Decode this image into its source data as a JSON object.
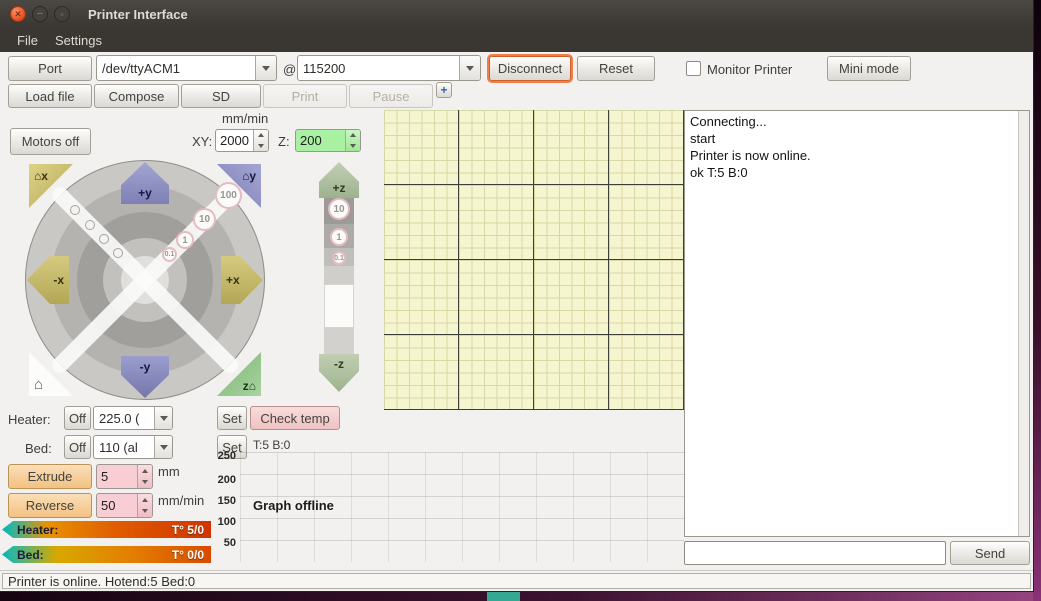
{
  "window": {
    "title": "Printer Interface",
    "menu": {
      "file": "File",
      "settings": "Settings"
    }
  },
  "connect_bar": {
    "port_button": "Port",
    "port_value": "/dev/ttyACM1",
    "at": "@",
    "baud_value": "115200",
    "disconnect_button": "Disconnect",
    "reset_button": "Reset",
    "monitor_checkbox": "Monitor Printer",
    "mini_mode_button": "Mini mode"
  },
  "file_bar": {
    "load_file": "Load file",
    "compose": "Compose",
    "sd": "SD",
    "print": "Print",
    "pause": "Pause",
    "add": "+"
  },
  "motion": {
    "motors_off": "Motors off",
    "feed_header": "mm/min",
    "xy_label": "XY:",
    "xy_feed": "2000",
    "z_label": "Z:",
    "z_feed": "200",
    "jog": {
      "home_x": "⌂x",
      "home_y": "⌂y",
      "home_all": "⌂",
      "home_z": "z⌂",
      "x_minus": "-x",
      "x_plus": "+x",
      "y_plus": "+y",
      "y_minus": "-y",
      "z_plus": "+z",
      "z_minus": "-z",
      "xy_steps": [
        "100",
        "10",
        "1",
        "0.1"
      ],
      "z_steps": [
        "10",
        "1",
        "0.1"
      ]
    }
  },
  "temperature": {
    "heater_label": "Heater:",
    "heater_off": "Off",
    "heater_preset": "225.0 (",
    "heater_set": "Set",
    "check_temp": "Check temp",
    "bed_label": "Bed:",
    "bed_off": "Off",
    "bed_preset": "110 (al",
    "bed_set": "Set",
    "readout": "T:5 B:0"
  },
  "extrusion": {
    "extrude": "Extrude",
    "length": "5",
    "length_unit": "mm",
    "reverse": "Reverse",
    "speed": "50",
    "speed_unit": "mm/min"
  },
  "gauges": {
    "heater": {
      "label": "Heater:",
      "value": "T° 5/0"
    },
    "bed": {
      "label": "Bed:",
      "value": "T° 0/0"
    }
  },
  "graph": {
    "y_ticks": [
      "250",
      "200",
      "150",
      "100",
      "50"
    ],
    "status": "Graph offline"
  },
  "console": {
    "lines": [
      "Connecting...",
      "start",
      "Printer is now online.",
      "ok T:5 B:0"
    ],
    "send_button": "Send"
  },
  "status_bar": "Printer is online. Hotend:5 Bed:0",
  "colors": {
    "accent_orange": "#ef7e48",
    "x_axis": "#c9bd6f",
    "y_axis": "#8b8dc4",
    "z_axis": "#93c793",
    "highlight_green": "#aaf0a2",
    "highlight_pink": "#f8cdd4",
    "bed_grid_bg": "#f5f5cf"
  }
}
